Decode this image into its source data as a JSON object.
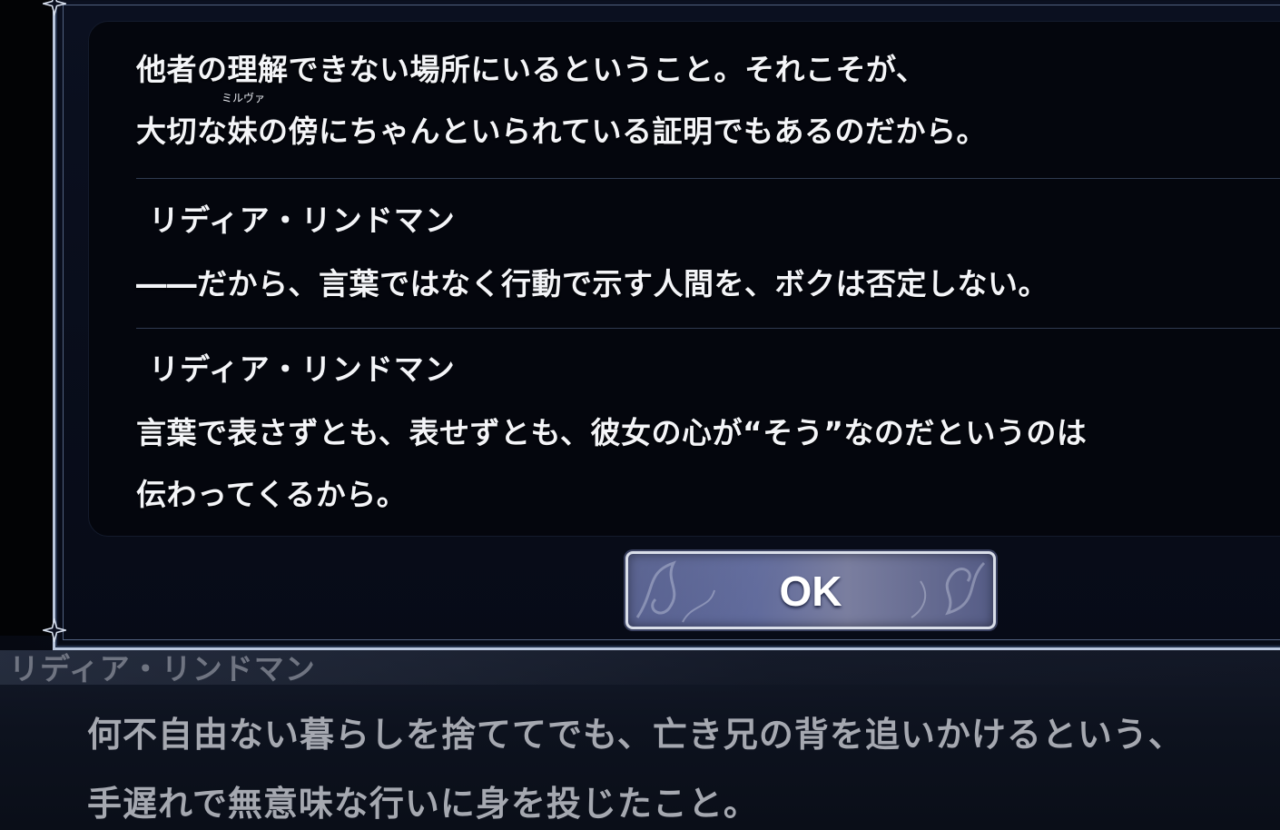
{
  "backlog": {
    "entries": [
      {
        "speaker": "",
        "ruby": "ミルヴァ",
        "lines": [
          "他者の理解できない場所にいるということ。それこそが、",
          "大切な妹の傍にちゃんといられている証明でもあるのだから。"
        ]
      },
      {
        "speaker": "リディア・リンドマン",
        "lines": [
          "――だから、言葉ではなく行動で示す人間を、ボクは否定しない。"
        ]
      },
      {
        "speaker": "リディア・リンドマン",
        "lines": [
          "言葉で表さずとも、表せずとも、彼女の心が“そう”なのだというのは",
          "伝わってくるから。"
        ]
      }
    ],
    "ok_label": "OK"
  },
  "message_box": {
    "speaker": "リディア・リンドマン",
    "lines": [
      "何不自由ない暮らしを捨ててでも、亡き兄の背を追いかけるという、",
      "手遅れで無意味な行いに身を投じたこと。"
    ]
  },
  "colors": {
    "frame_border": "#b9c6dd",
    "panel_bg": "#04060d",
    "text": "#f4f5f8",
    "ok_button": "#616b9c",
    "dim_text": "#a5a8b0"
  },
  "icons": [
    "corner-star-icon",
    "filigree-ornament-icon"
  ]
}
